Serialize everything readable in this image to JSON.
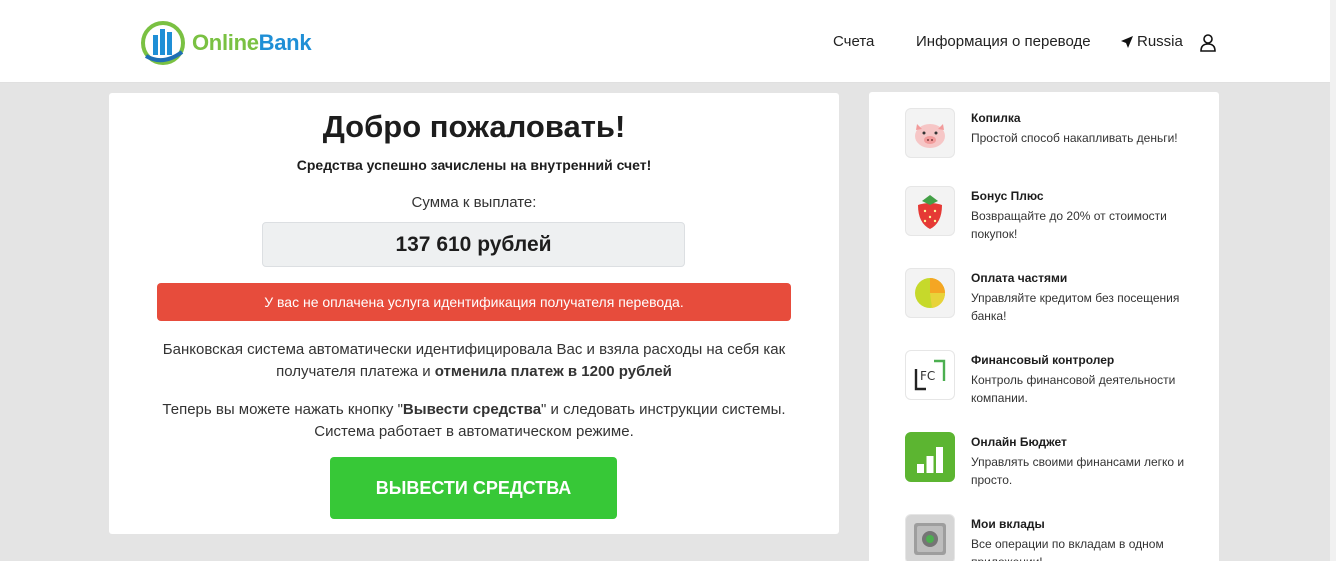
{
  "header": {
    "logo": {
      "word_online": "Online",
      "word_bank": "Bank"
    },
    "nav": {
      "accounts": "Счета",
      "transfer_info": "Информация о переводе",
      "language": "Russia"
    }
  },
  "main": {
    "welcome": "Добро пожаловать!",
    "credited_message": "Средства успешно зачислены на внутренний счет!",
    "amount_label": "Сумма к выплате:",
    "amount_value": "137 610 рублей",
    "alert_text": "У вас не оплачена услуга идентификация получателя перевода.",
    "info1_text": "Банковская система автоматически идентифицировала Вас и взяла расходы на себя как получателя платежа и ",
    "info1_bold": "отменила платеж в 1200 рублей",
    "info2_part1": "Теперь вы можете нажать кнопку \"",
    "info2_bold": "Вывести средства",
    "info2_part2": "\" и следовать инструкции системы. Система работает в автоматическом режиме.",
    "withdraw_button": "ВЫВЕСТИ СРЕДСТВА"
  },
  "services": [
    {
      "icon": "piggy-bank-icon",
      "title": "Копилка",
      "desc": "Простой способ накапливать деньги!"
    },
    {
      "icon": "strawberry-icon",
      "title": "Бонус Плюс",
      "desc": "Возвращайте до 20% от стоимости покупок!"
    },
    {
      "icon": "pie-chart-icon",
      "title": "Оплата частями",
      "desc": "Управляйте кредитом без посещения банка!"
    },
    {
      "icon": "fc-icon",
      "title": "Финансовый контролер",
      "desc": "Контроль финансовой деятельности компании."
    },
    {
      "icon": "bar-chart-icon",
      "title": "Онлайн Бюджет",
      "desc": "Управлять своими финансами легко и просто."
    },
    {
      "icon": "safe-icon",
      "title": "Мои вклады",
      "desc": "Все операции по вкладам в одном приложении!"
    }
  ],
  "colors": {
    "alert": "#e74c3c",
    "withdraw": "#37c837",
    "logo_green": "#7ac142",
    "logo_blue": "#1f8fd6"
  }
}
